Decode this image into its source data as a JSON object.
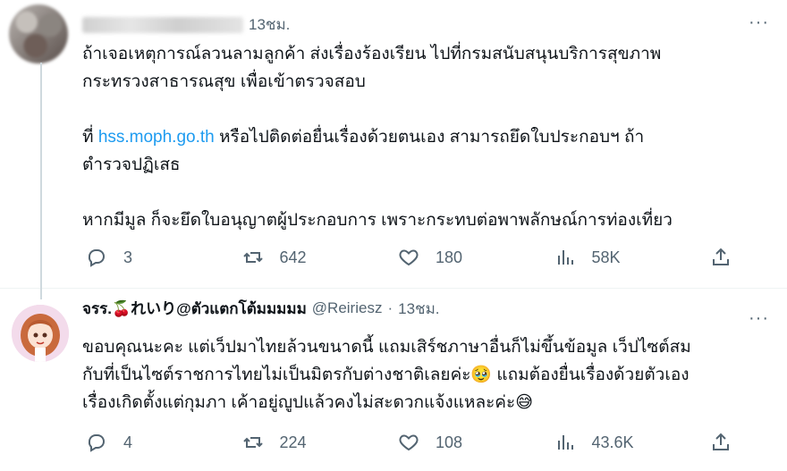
{
  "tweet1": {
    "time": "13ชม.",
    "line1": "ถ้าเจอเหตุการณ์ลวนลามลูกค้า ส่งเรื่องร้องเรียน ไปที่กรมสนับสนุนบริการสุขภาพ",
    "line2": "กระทรวงสาธารณสุข เพื่อเข้าตรวจสอบ",
    "line3_prefix": "ที่ ",
    "link": "hss.moph.go.th",
    "line3_suffix": " หรือไปติดต่อยื่นเรื่องด้วยตนเอง สามารถยึดใบประกอบฯ ถ้า",
    "line4": "ตำรวจปฏิเสธ",
    "line5": "หากมีมูล ก็จะยึดใบอนุญาตผู้ประกอบการ เพราะกระทบต่อพาพลักษณ์การท่องเที่ยว",
    "replies": "3",
    "reposts": "642",
    "likes": "180",
    "views": "58K"
  },
  "tweet2": {
    "name_prefix": "จรร.",
    "name_emoji": "🍒",
    "name_suffix": "れいり@ตัวแตกโต้มมมมม",
    "handle": "@Reiriesz",
    "separator": "·",
    "time": "13ชม.",
    "line1": "ขอบคุณนะคะ แต่เว็ปมาไทยล้วนขนาดนี้ แถมเสิร์ชภาษาอื่นก็ไม่ขึ้นข้อมูล เว็ปไซต์สม",
    "line2": "กับที่เป็นไซต์ราชการไทยไม่เป็นมิตรกับต่างชาติเลยค่ะ",
    "line2_emoji": "🥹",
    "line2_suffix": " แถมต้องยื่นเรื่องด้วยตัวเอง",
    "line3": "เรื่องเกิดตั้งแต่กุมภา เค้าอยู่ญูปแล้วคงไม่สะดวกแจ้งแหละค่ะ",
    "line3_emoji": "😅",
    "replies": "4",
    "reposts": "224",
    "likes": "108",
    "views": "43.6K"
  },
  "more_label": "···"
}
